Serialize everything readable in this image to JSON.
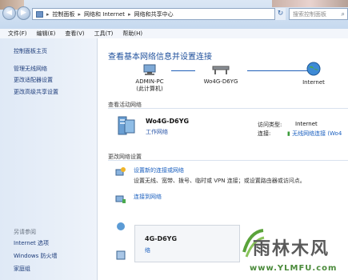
{
  "address_bar": {
    "crumbs": [
      "控制面板",
      "网络和 Internet",
      "网络和共享中心"
    ],
    "search_placeholder": "搜索控制面板"
  },
  "menu": [
    "文件(F)",
    "编辑(E)",
    "查看(V)",
    "工具(T)",
    "帮助(H)"
  ],
  "sidebar": {
    "items": [
      "控制面板主页",
      "管理无线网络",
      "更改适配器设置",
      "更改高级共享设置"
    ],
    "see_also_header": "另请参阅",
    "see_also": [
      "Internet 选项",
      "Windows 防火墙",
      "家庭组"
    ]
  },
  "main": {
    "title": "查看基本网络信息并设置连接",
    "map": {
      "pc_name": "ADMIN-PC",
      "pc_sub": "(此计算机)",
      "network_name": "Wo4G-D6YG",
      "internet": "Internet"
    },
    "active_header": "查看活动网络",
    "active": {
      "name": "Wo4G-D6YG",
      "type": "工作网络",
      "access_label": "访问类型:",
      "access_value": "Internet",
      "conn_label": "连接:",
      "conn_value": "无线网络连接 (Wo4"
    },
    "change_header": "更改网络设置",
    "tasks": [
      {
        "title": "设置新的连接或网络",
        "desc": "设置无线、宽带、拨号、临时或 VPN 连接；或设置路由器或访问点。"
      },
      {
        "title": "连接到网络",
        "desc": ""
      }
    ],
    "popup": {
      "name": "4G-D6YG",
      "link": "络"
    }
  },
  "watermark": {
    "text": "雨林木风",
    "url": "www.YLMFU.com"
  },
  "colors": {
    "accent": "#1e4f9b",
    "link": "#1a5fbf",
    "sidebar_bg": "#e4edf8"
  }
}
